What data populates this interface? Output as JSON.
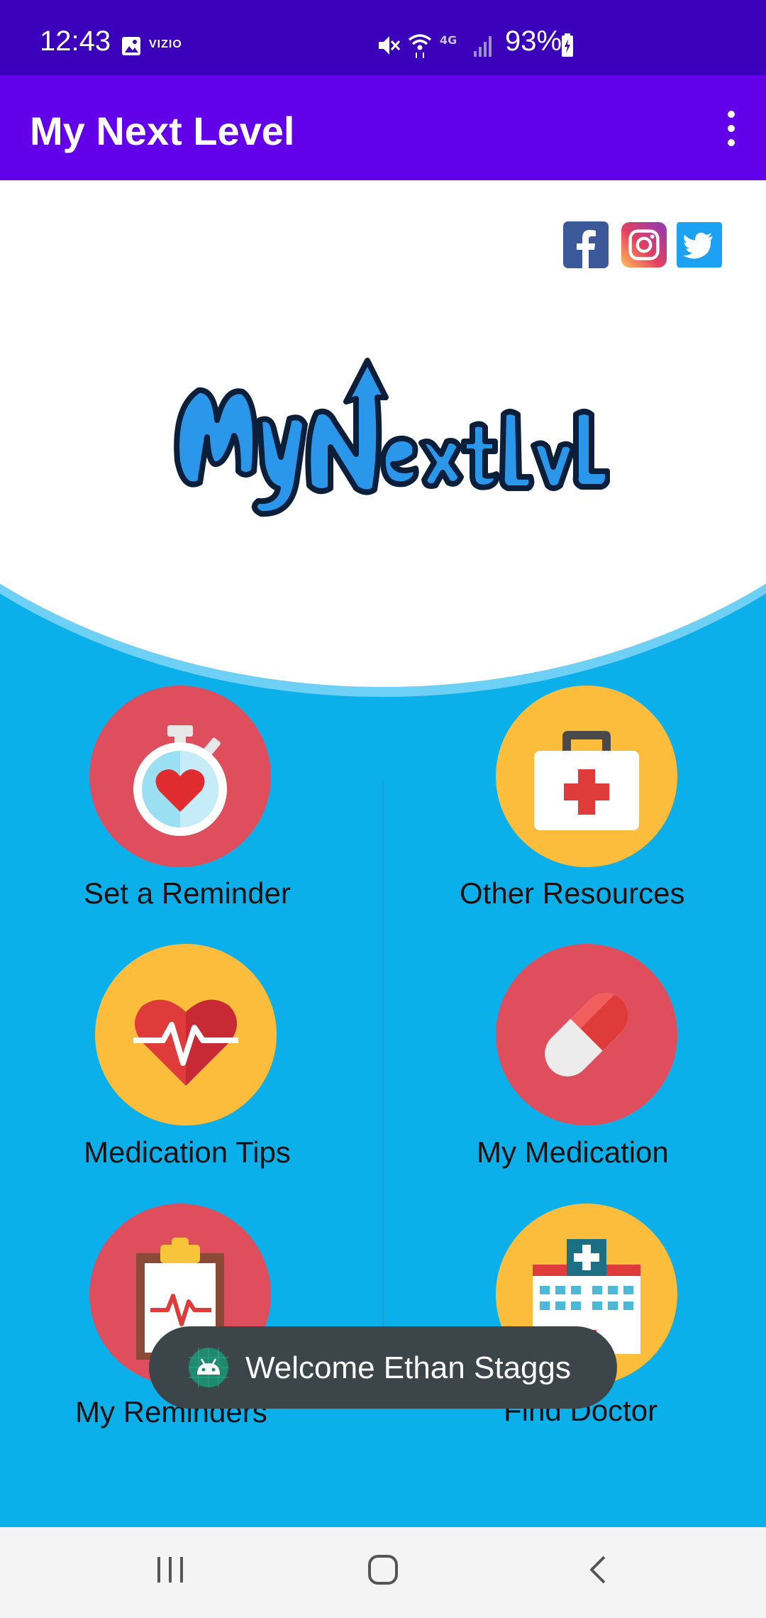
{
  "status_bar": {
    "time": "12:43",
    "carrier_logo": "VIZIO",
    "battery_text": "93%",
    "icons": [
      "image-icon",
      "mute-icon",
      "wifi-icon",
      "lte-icon",
      "signal-icon",
      "battery-icon"
    ]
  },
  "app_bar": {
    "title": "My Next Level",
    "menu_icon": "more-vert-icon"
  },
  "social": [
    "facebook-icon",
    "instagram-icon",
    "twitter-icon"
  ],
  "logo_text": "MyNextLvL",
  "menu_items": [
    {
      "label": "Set a Reminder",
      "icon": "stopwatch-heart-icon"
    },
    {
      "label": "Other Resources",
      "icon": "first-aid-kit-icon"
    },
    {
      "label": "Medication Tips",
      "icon": "heartbeat-icon"
    },
    {
      "label": "My Medication",
      "icon": "pill-icon"
    },
    {
      "label": "My Reminders",
      "icon": "clipboard-icon"
    },
    {
      "label": "Find Doctor",
      "icon": "hospital-icon"
    }
  ],
  "toast": {
    "message": "Welcome Ethan Staggs",
    "icon": "android-icon"
  },
  "nav_bar": [
    "recent-apps-icon",
    "home-icon",
    "back-icon"
  ],
  "colors": {
    "status_bar": "#3b00ba",
    "app_bar": "#6200ea",
    "content_bg": "#0bb0ea",
    "circle_red": "#df4e5d",
    "circle_yellow": "#fbbd3b"
  }
}
